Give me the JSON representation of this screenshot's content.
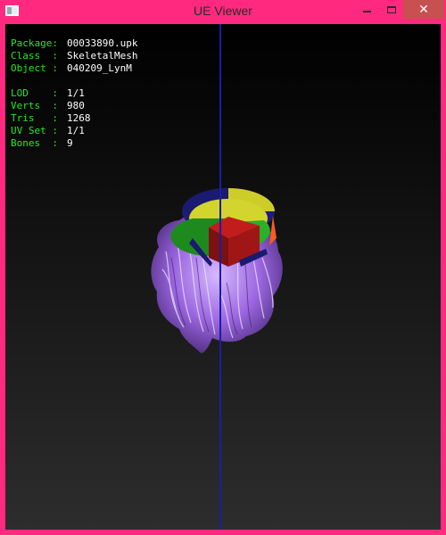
{
  "window": {
    "title": "UE Viewer",
    "icon": "app-icon",
    "controls": {
      "minimize": "minimize-icon",
      "maximize": "maximize-icon",
      "close": "close-icon",
      "close_glyph": "✕"
    }
  },
  "colors": {
    "frame": "#ff2a7f",
    "label": "#27e627",
    "value": "#ffffff",
    "axis": "#1c1ca8",
    "hair": "#a173e0"
  },
  "info": {
    "package": {
      "label": "Package:",
      "value": "00033890.upk"
    },
    "class": {
      "label": "Class  :",
      "value": "SkeletalMesh"
    },
    "object": {
      "label": "Object :",
      "value": "040209_LynM"
    },
    "lod": {
      "label": "LOD    :",
      "value": "1/1"
    },
    "verts": {
      "label": "Verts  :",
      "value": "980"
    },
    "tris": {
      "label": "Tris   :",
      "value": "1268"
    },
    "uvset": {
      "label": "UV Set :",
      "value": "1/1"
    },
    "bones": {
      "label": "Bones  :",
      "value": "9"
    }
  }
}
